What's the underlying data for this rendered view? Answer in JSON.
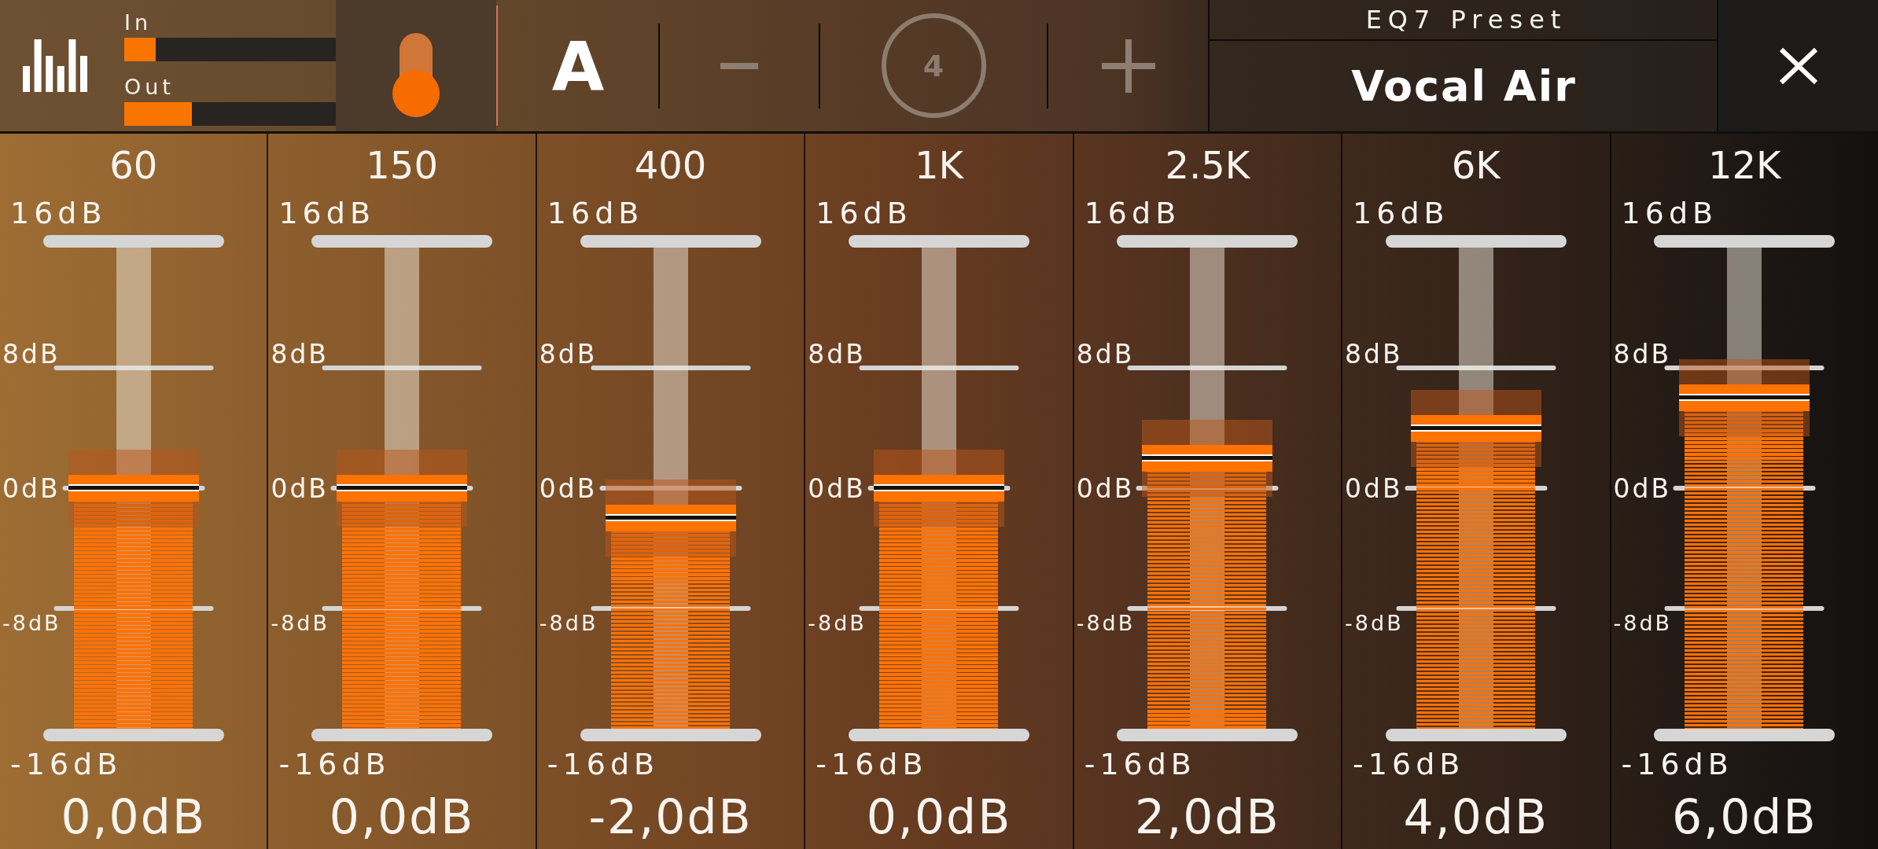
{
  "toolbar": {
    "meters": [
      {
        "label": "In",
        "level": 0.15
      },
      {
        "label": "Out",
        "level": 0.32
      }
    ],
    "switch": {
      "on": true
    },
    "slot": {
      "label": "A"
    },
    "stepper": {
      "minus": {
        "disabled": true
      },
      "number": "4",
      "plus": {
        "disabled": true
      }
    },
    "preset": {
      "title": "EQ7 Preset",
      "name": "Vocal Air"
    }
  },
  "channels": [
    {
      "frequency": "60",
      "scale": [
        "16dB",
        "8dB",
        "0dB",
        "-8dB",
        "-16dB"
      ],
      "level": 0.5,
      "reading": "0,0dB"
    },
    {
      "frequency": "150",
      "scale": [
        "16dB",
        "8dB",
        "0dB",
        "-8dB",
        "-16dB"
      ],
      "level": 0.5,
      "reading": "0,0dB"
    },
    {
      "frequency": "400",
      "scale": [
        "16dB",
        "8dB",
        "0dB",
        "-8dB",
        "-16dB"
      ],
      "level": 0.4375,
      "reading": "-2,0dB"
    },
    {
      "frequency": "1K",
      "scale": [
        "16dB",
        "8dB",
        "0dB",
        "-8dB",
        "-16dB"
      ],
      "level": 0.5,
      "reading": "0,0dB"
    },
    {
      "frequency": "2.5K",
      "scale": [
        "16dB",
        "8dB",
        "0dB",
        "-8dB",
        "-16dB"
      ],
      "level": 0.5625,
      "reading": "2,0dB"
    },
    {
      "frequency": "6K",
      "scale": [
        "16dB",
        "8dB",
        "0dB",
        "-8dB",
        "-16dB"
      ],
      "level": 0.625,
      "reading": "4,0dB"
    },
    {
      "frequency": "12K",
      "scale": [
        "16dB",
        "8dB",
        "0dB",
        "-8dB",
        "-16dB"
      ],
      "level": 0.6875,
      "reading": "6,0dB"
    }
  ]
}
